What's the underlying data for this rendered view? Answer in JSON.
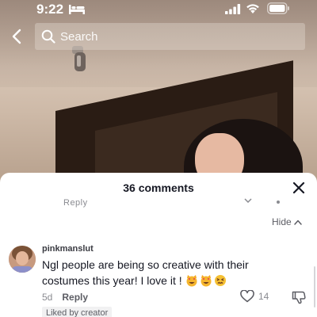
{
  "status_bar": {
    "time": "9:22",
    "icons": [
      "bed-icon",
      "signal-icon",
      "wifi-icon",
      "battery-icon"
    ]
  },
  "header": {
    "back_icon": "chevron-left-icon",
    "search": {
      "placeholder": "Search",
      "icon": "search-icon"
    }
  },
  "comments": {
    "title": "36 comments",
    "close_icon": "close-icon",
    "clipped_row": {
      "reply_text": "Reply"
    },
    "hide_label": "Hide",
    "items": [
      {
        "username": "pinkmanslut",
        "text": "Ngl people are being so creative with their costumes this year! I love it !",
        "emojis": [
          "smiling-cat-heart-eyes-emoji",
          "smiling-cat-heart-eyes-emoji",
          "confounded-face-emoji"
        ],
        "time": "5d",
        "reply_label": "Reply",
        "likes": "14",
        "badge": "Liked by creator"
      }
    ]
  },
  "colors": {
    "sheet_bg": "#ffffff",
    "primary_text": "#161823",
    "secondary_text": "#8a8b91",
    "badge_bg": "#f1f1f2"
  }
}
